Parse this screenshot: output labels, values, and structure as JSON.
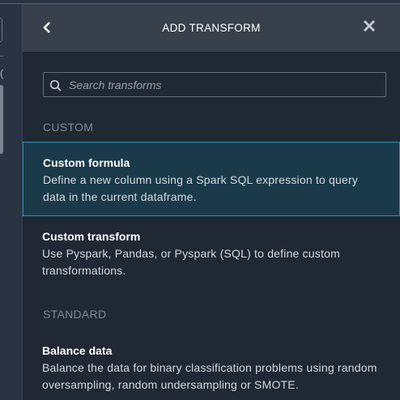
{
  "header": {
    "title": "ADD TRANSFORM",
    "back_icon": "chevron-left-icon",
    "close_icon": "close-icon"
  },
  "search": {
    "placeholder": "Search transforms",
    "value": ""
  },
  "sections": [
    {
      "label": "CUSTOM",
      "items": [
        {
          "title": "Custom formula",
          "description": "Define a new column using a Spark SQL expression to query data in the current dataframe.",
          "selected": true
        },
        {
          "title": "Custom transform",
          "description": "Use Pyspark, Pandas, or Pyspark (SQL) to define custom transformations.",
          "selected": false
        }
      ]
    },
    {
      "label": "STANDARD",
      "items": [
        {
          "title": "Balance data",
          "description": "Balance the data for binary classification problems using random oversampling, random undersampling or SMOTE.",
          "selected": false
        }
      ]
    }
  ],
  "background": {
    "char": "("
  },
  "colors": {
    "accent": "#00a1c9",
    "panel": "#1f2833",
    "header": "#38414b"
  }
}
